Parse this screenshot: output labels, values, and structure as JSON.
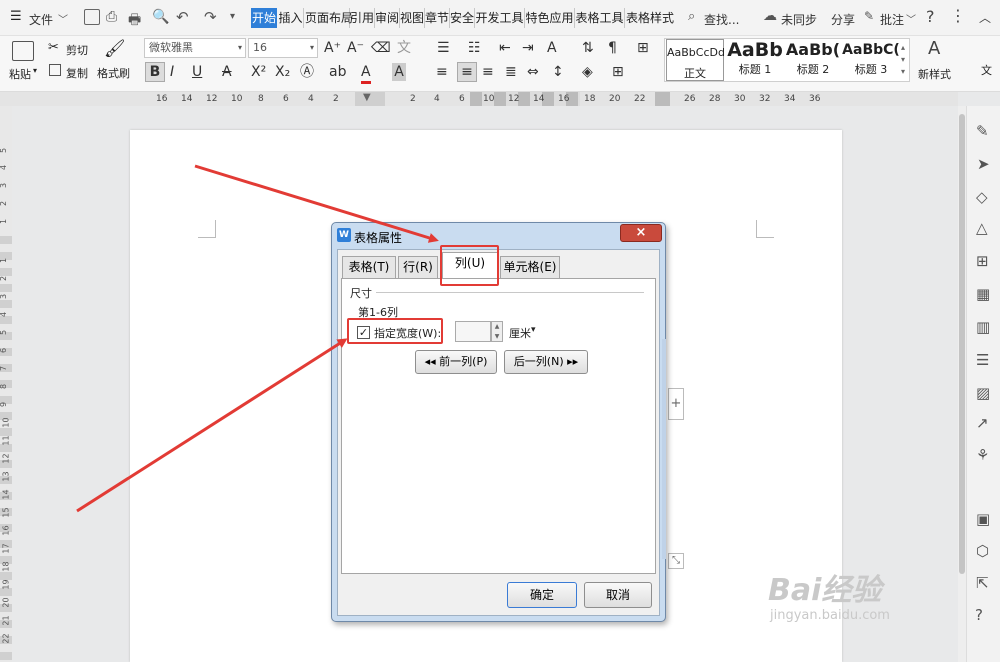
{
  "menubar": {
    "file_label": "文件",
    "tabs": [
      "开始",
      "插入",
      "页面布局",
      "引用",
      "审阅",
      "视图",
      "章节",
      "安全",
      "开发工具",
      "特色应用",
      "表格工具",
      "表格样式"
    ],
    "search_label": "查找...",
    "sync_label": "未同步",
    "share_label": "分享",
    "comment_label": "批注",
    "help": "?"
  },
  "ribbon": {
    "paste": "粘贴",
    "cut": "剪切",
    "copy": "复制",
    "format_painter": "格式刷",
    "font_name": "微软雅黑",
    "font_size": "16",
    "styles": [
      {
        "preview": "AaBbCcDd",
        "label": "正文"
      },
      {
        "preview": "AaBb",
        "label": "标题 1"
      },
      {
        "preview": "AaBb(",
        "label": "标题 2"
      },
      {
        "preview": "AaBbC(",
        "label": "标题 3"
      }
    ],
    "new_style": "新样式",
    "text_tool": "文"
  },
  "ruler": {
    "numbers": [
      "16",
      "14",
      "12",
      "10",
      "8",
      "6",
      "4",
      "2",
      "2",
      "4",
      "6",
      "10",
      "12",
      "14",
      "16",
      "18",
      "20",
      "22",
      "26",
      "28",
      "30",
      "32",
      "34",
      "36"
    ]
  },
  "vruler": {
    "numbers": [
      "5",
      "4",
      "3",
      "2",
      "1",
      "1",
      "2",
      "3",
      "4",
      "5",
      "6",
      "7",
      "8",
      "9",
      "10",
      "11",
      "12",
      "13",
      "14",
      "15",
      "16",
      "17",
      "18",
      "19",
      "20",
      "21",
      "22"
    ]
  },
  "dialog": {
    "title": "表格属性",
    "close": "×",
    "tabs": [
      "表格(T)",
      "行(R)",
      "列(U)",
      "单元格(E)"
    ],
    "section": "尺寸",
    "column_info": "第1-6列",
    "specify_width": "指定宽度(W):",
    "width_value": "",
    "unit": "厘米",
    "prev_col": "◂◂ 前一列(P)",
    "next_col": "后一列(N) ▸▸",
    "ok": "确定",
    "cancel": "取消"
  },
  "watermark": {
    "main": "Bai经验",
    "sub": "jingyan.baidu.com"
  },
  "colors": {
    "accent": "#2f7fd8",
    "annotation": "#e23b35"
  }
}
